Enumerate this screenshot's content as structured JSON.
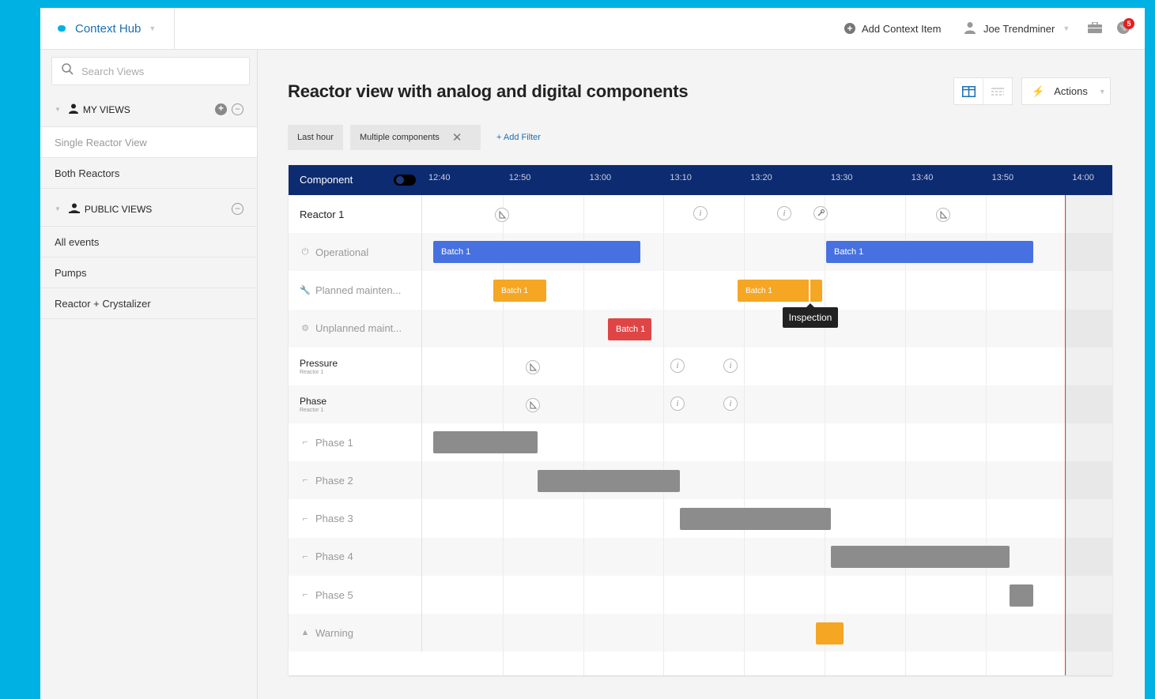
{
  "topbar": {
    "brand": "Context Hub",
    "add_context": "Add Context Item",
    "user": "Joe Trendminer",
    "notifications_count": "5"
  },
  "sidebar": {
    "search_placeholder": "Search Views",
    "my_views_label": "MY VIEWS",
    "my_views": [
      "Single Reactor View",
      "Both Reactors"
    ],
    "public_views_label": "PUBLIC VIEWS",
    "public_views": [
      "All events",
      "Pumps",
      "Reactor + Crystalizer"
    ]
  },
  "main": {
    "title": "Reactor view with analog and digital components",
    "actions_label": "Actions",
    "filters": [
      "Last hour",
      "Multiple components"
    ],
    "add_filter": "+ Add Filter"
  },
  "timeline": {
    "component_header": "Component",
    "ticks": [
      "12:40",
      "12:50",
      "13:00",
      "13:10",
      "13:20",
      "13:30",
      "13:40",
      "13:50",
      "14:00"
    ],
    "rows": [
      {
        "label": "Reactor 1",
        "sub": ""
      },
      {
        "label": "Operational",
        "sub": ""
      },
      {
        "label": "Planned mainten...",
        "sub": ""
      },
      {
        "label": "Unplanned maint...",
        "sub": ""
      },
      {
        "label": "Pressure",
        "sub": "Reactor 1"
      },
      {
        "label": "Phase",
        "sub": "Reactor 1"
      },
      {
        "label": "Phase 1",
        "sub": ""
      },
      {
        "label": "Phase 2",
        "sub": ""
      },
      {
        "label": "Phase 3",
        "sub": ""
      },
      {
        "label": "Phase 4",
        "sub": ""
      },
      {
        "label": "Phase 5",
        "sub": ""
      },
      {
        "label": "Warning",
        "sub": ""
      }
    ],
    "bar_labels": {
      "operational_1": "Batch 1",
      "operational_2": "Batch 1",
      "planned_1": "Batch 1",
      "planned_2": "Batch 1",
      "unplanned_1": "Batch 1"
    },
    "tooltip": "Inspection",
    "info_glyph": "i",
    "colors": {
      "header": "#0d2b70",
      "operational": "#4771e0",
      "planned": "#f5a623",
      "unplanned": "#e04545",
      "phase": "#8c8c8c",
      "now_line": "#e53935",
      "accent": "#00b2e3"
    }
  }
}
